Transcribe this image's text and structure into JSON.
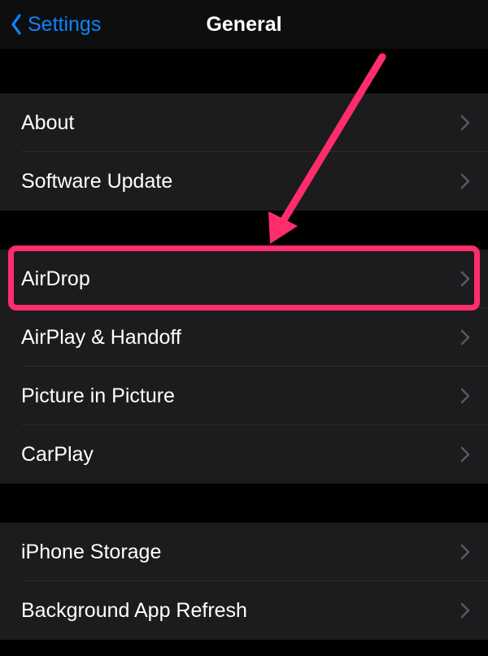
{
  "nav": {
    "back_label": "Settings",
    "title": "General"
  },
  "groups": [
    {
      "rows": [
        {
          "key": "about",
          "label": "About"
        },
        {
          "key": "software-update",
          "label": "Software Update"
        }
      ]
    },
    {
      "rows": [
        {
          "key": "airdrop",
          "label": "AirDrop",
          "highlighted": true
        },
        {
          "key": "airplay-handoff",
          "label": "AirPlay & Handoff"
        },
        {
          "key": "picture-in-picture",
          "label": "Picture in Picture"
        },
        {
          "key": "carplay",
          "label": "CarPlay"
        }
      ]
    },
    {
      "rows": [
        {
          "key": "iphone-storage",
          "label": "iPhone Storage"
        },
        {
          "key": "background-app-refresh",
          "label": "Background App Refresh"
        }
      ]
    }
  ],
  "annotation": {
    "highlight_color": "#ff2d6c",
    "arrow_color": "#ff2d6c"
  }
}
